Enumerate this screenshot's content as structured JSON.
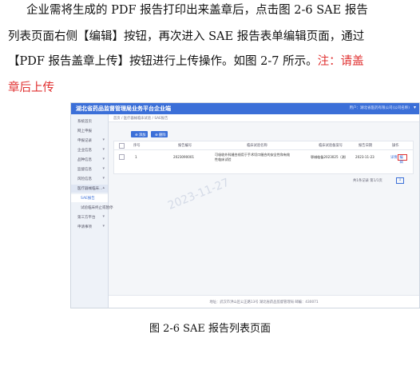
{
  "paragraph": {
    "line1": "企业需将生成的 PDF 报告打印出来盖章后，点击图 2-6 SAE 报告",
    "line2": "列表页面右侧【编辑】按钮，再次进入 SAE 报告表单编辑页面，通过",
    "line3_a": "【PDF 报告盖章上传】按钮进行上传操作。如图 2-7 所示。",
    "line3_note": "注：请盖",
    "line4_note": "章后上传"
  },
  "screenshot": {
    "app_title": "湖北省药品监督管理局业务平台企业端",
    "user_info": "用户：湖北省医药有限公司(公司名称)",
    "user_caret": "▾",
    "sidebar": [
      {
        "label": "系统首页",
        "chevron": ""
      },
      {
        "label": "网上申报",
        "chevron": ""
      },
      {
        "label": "申报记录",
        "chevron": "▾"
      },
      {
        "label": "企业信息",
        "chevron": "▾"
      },
      {
        "label": "品种信息",
        "chevron": "▾"
      },
      {
        "label": "监督信息",
        "chevron": "▾"
      },
      {
        "label": "风险信息",
        "chevron": "▾"
      },
      {
        "label": "医疗器械临床...",
        "chevron": "▴"
      },
      {
        "label": "SAE报告",
        "chevron": ""
      },
      {
        "label": "试验临床终止或暂停",
        "chevron": ""
      },
      {
        "label": "第三方平台",
        "chevron": "▾"
      },
      {
        "label": "申请事项",
        "chevron": "▾"
      }
    ],
    "breadcrumb": "首页 / 医疗器械临床试验 / SAE报告",
    "buttons": {
      "add": "⊕ 添加",
      "delete": "⊗ 删除"
    },
    "table": {
      "headers": [
        "序号",
        "报告编号",
        "临床试验名称",
        "临床试验备案号",
        "报告日期",
        "操作"
      ],
      "rows": [
        {
          "index": "1",
          "report_no": "2023090001",
          "trial_name_1": "可吸收外科缝合线用于手术切口缝合的安全性和有效",
          "trial_name_2": "性临床试验",
          "record_no": "鄂械临备2023025（测）",
          "date": "2023-11-23",
          "view": "详情",
          "edit": "编辑"
        }
      ]
    },
    "pager": "共1条记录 第1/1页",
    "pager_page": "1",
    "footer": "地址：武汉市洪山区公正路13号 湖北省药品监督管理局 邮编：430071",
    "watermark": "2023-11-27"
  },
  "caption": "图 2-6    SAE 报告列表页面"
}
